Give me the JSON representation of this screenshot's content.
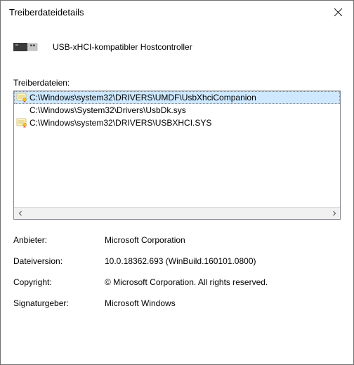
{
  "window_title": "Treiberdateidetails",
  "device_name": "USB-xHCI-kompatibler Hostcontroller",
  "files_label": "Treiberdateien:",
  "files": [
    {
      "path": "C:\\Windows\\system32\\DRIVERS\\UMDF\\UsbXhciCompanion",
      "icon": true,
      "selected": true
    },
    {
      "path": "C:\\Windows\\System32\\Drivers\\UsbDk.sys",
      "icon": false,
      "selected": false
    },
    {
      "path": "C:\\Windows\\system32\\DRIVERS\\USBXHCI.SYS",
      "icon": true,
      "selected": false
    }
  ],
  "details": {
    "provider_label": "Anbieter:",
    "provider_value": "Microsoft Corporation",
    "version_label": "Dateiversion:",
    "version_value": "10.0.18362.693 (WinBuild.160101.0800)",
    "copyright_label": "Copyright:",
    "copyright_value": "© Microsoft Corporation. All rights reserved.",
    "signer_label": "Signaturgeber:",
    "signer_value": "Microsoft Windows"
  }
}
